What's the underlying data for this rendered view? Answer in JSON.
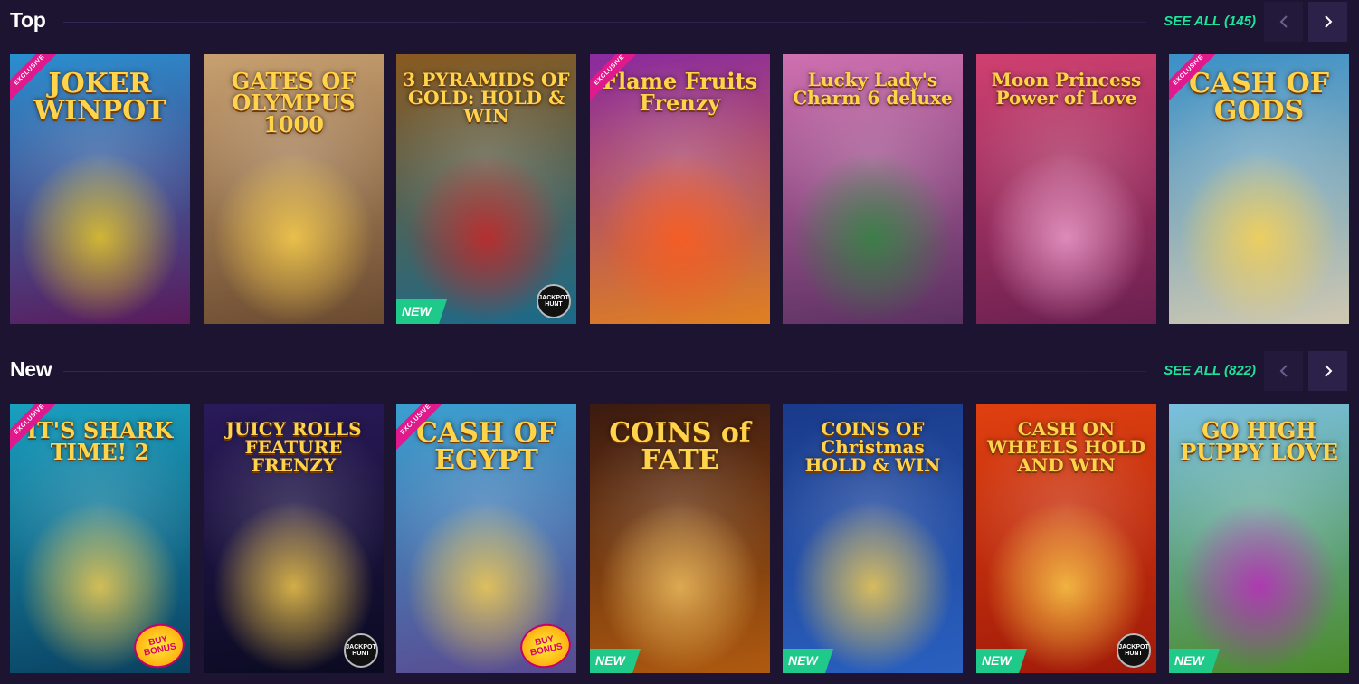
{
  "sections": [
    {
      "title": "Top",
      "see_all": "SEE ALL (145)",
      "games": [
        {
          "title": "JOKER WINPOT",
          "exclusive": "EXCLUSIVE",
          "bg": [
            "#2a8fd0",
            "#5a1a5a"
          ],
          "accent": "#f0d020"
        },
        {
          "title": "GATES OF OLYMPUS 1000",
          "bg": [
            "#c8a070",
            "#6a4a30"
          ],
          "accent": "#ffd34a"
        },
        {
          "title": "3 PYRAMIDS OF GOLD: HOLD & WIN",
          "new": "NEW",
          "jh": "JACKPOT HUNT",
          "bg": [
            "#8a5a20",
            "#1a6a8a"
          ],
          "accent": "#d02020"
        },
        {
          "title": "Flame Fruits Frenzy",
          "exclusive": "EXCLUSIVE",
          "bg": [
            "#8a2aa0",
            "#e08020"
          ],
          "accent": "#ff5a1a"
        },
        {
          "title": "Lucky Lady's Charm 6 deluxe",
          "bg": [
            "#d070b0",
            "#5a3060"
          ],
          "accent": "#2a8a3a"
        },
        {
          "title": "Moon Princess Power of Love",
          "bg": [
            "#d04070",
            "#6a2050"
          ],
          "accent": "#f0a0d0"
        },
        {
          "title": "CASH OF GODS",
          "exclusive": "EXCLUSIVE",
          "bg": [
            "#3a90c8",
            "#d0c8b0"
          ],
          "accent": "#ffd34a"
        }
      ]
    },
    {
      "title": "New",
      "see_all": "SEE ALL (822)",
      "games": [
        {
          "title": "IT'S SHARK TIME! 2",
          "exclusive": "EXCLUSIVE",
          "bb": "BUY BONUS",
          "bg": [
            "#1aa0c0",
            "#0a4060"
          ],
          "accent": "#ffd34a"
        },
        {
          "title": "JUICY ROLLS FEATURE FRENZY",
          "jh": "JACKPOT HUNT",
          "bg": [
            "#2a1a5a",
            "#0a0a20"
          ],
          "accent": "#ffd34a"
        },
        {
          "title": "CASH OF EGYPT",
          "exclusive": "EXCLUSIVE",
          "bb": "BUY BONUS",
          "bg": [
            "#3aa0d0",
            "#5a4a90"
          ],
          "accent": "#ffd34a"
        },
        {
          "title": "COINS of FATE",
          "new": "NEW",
          "bg": [
            "#3a1a10",
            "#b05a10"
          ],
          "accent": "#f0c060"
        },
        {
          "title": "COINS OF Christmas HOLD & WIN",
          "new": "NEW",
          "bg": [
            "#1a3a8a",
            "#2a60c0"
          ],
          "accent": "#ffd34a"
        },
        {
          "title": "CASH ON WHEELS HOLD AND WIN",
          "new": "NEW",
          "jh": "JACKPOT HUNT",
          "bg": [
            "#e04010",
            "#a01a0a"
          ],
          "accent": "#ffd34a"
        },
        {
          "title": "GO HIGH PUPPY LOVE",
          "new": "NEW",
          "bg": [
            "#7ac0e0",
            "#4a8a2a"
          ],
          "accent": "#c020c0"
        }
      ]
    }
  ],
  "nav": {
    "prev_icon": "chevron-left-icon",
    "next_icon": "chevron-right-icon"
  },
  "colors": {
    "background": "#1c1430",
    "accent_green": "#1ee39b",
    "exclusive_pink": "#e0198c",
    "new_green": "#1fc98a"
  }
}
